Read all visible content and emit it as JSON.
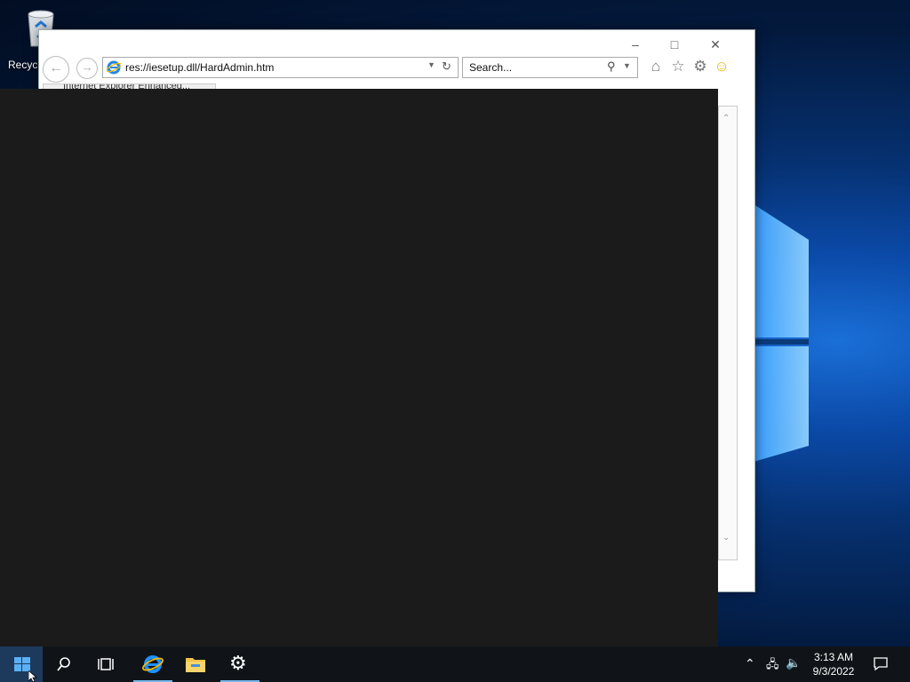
{
  "desktop": {
    "recycle_bin_label": "Recycl"
  },
  "browser": {
    "address": "res://iesetup.dll/HardAdmin.htm",
    "search_placeholder": "Search...",
    "tab_title": "Internet Explorer Enhanced..."
  },
  "taskbar": {
    "time": "3:13 AM",
    "date": "9/3/2022"
  },
  "colors": {
    "accent": "#76b9ed",
    "overlay": "#1b1b1b",
    "taskbar": "#101418"
  }
}
